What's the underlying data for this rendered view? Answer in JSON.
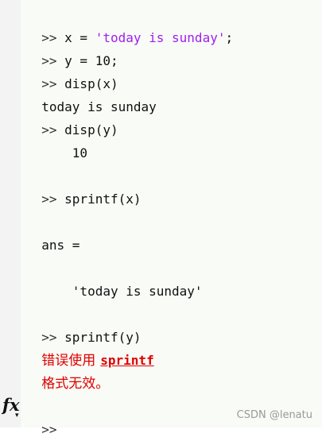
{
  "console": {
    "line1": {
      "prompt": ">>",
      "code_pre": " x = ",
      "string": "'today is sunday'",
      "code_post": ";"
    },
    "line2": {
      "prompt": ">>",
      "code": " y = 10;"
    },
    "line3": {
      "prompt": ">>",
      "code": " disp(x)"
    },
    "line4": {
      "output": "today is sunday"
    },
    "line5": {
      "prompt": ">>",
      "code": " disp(y)"
    },
    "line6": {
      "output": "    10"
    },
    "line7": {
      "prompt": ">>",
      "code": " sprintf(x)"
    },
    "line8": {
      "output": "ans ="
    },
    "line9": {
      "output": "    'today is sunday'"
    },
    "line10": {
      "prompt": ">>",
      "code": " sprintf(y)"
    },
    "line11": {
      "error_text": "错误使用",
      "error_link": "sprintf"
    },
    "line12": {
      "error_text": "格式无效。"
    },
    "line13": {
      "prompt": ">>"
    }
  },
  "gutter": {
    "fx_label": "fx",
    "fx_caret": "▾"
  },
  "watermark": "CSDN @lenatu",
  "colors": {
    "string": "#a020f0",
    "error": "#e00000",
    "console_bg": "#f8fbf6",
    "gutter_bg": "#f3f3f3"
  }
}
